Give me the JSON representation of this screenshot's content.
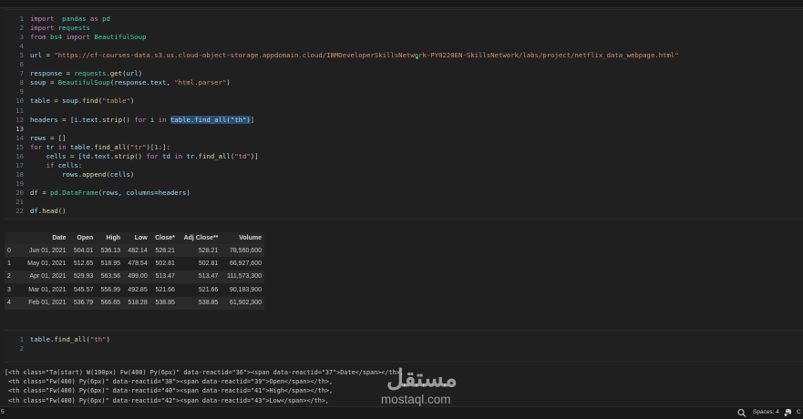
{
  "colors": {
    "background": "#1f1f1f",
    "keyword": "#c586c0",
    "string": "#ce9178",
    "function": "#dcdcaa",
    "variable": "#9cdcfe"
  },
  "cell1": {
    "lines": [
      {
        "num": "1",
        "tokens": [
          [
            "kw",
            "import"
          ],
          [
            "",
            "  "
          ],
          [
            "cls",
            "pandas"
          ],
          [
            "",
            " "
          ],
          [
            "kw",
            "as"
          ],
          [
            "",
            " "
          ],
          [
            "cls",
            "pd"
          ]
        ]
      },
      {
        "num": "2",
        "tokens": [
          [
            "kw",
            "import"
          ],
          [
            "",
            " "
          ],
          [
            "cls",
            "requests"
          ]
        ]
      },
      {
        "num": "3",
        "tokens": [
          [
            "kw",
            "from"
          ],
          [
            "",
            " "
          ],
          [
            "cls",
            "bs4"
          ],
          [
            "",
            " "
          ],
          [
            "kw",
            "import"
          ],
          [
            "",
            " "
          ],
          [
            "cls",
            "BeautifulSoup"
          ]
        ]
      },
      {
        "num": "4",
        "tokens": []
      },
      {
        "num": "5",
        "tokens": [
          [
            "var",
            "url"
          ],
          [
            "",
            " = "
          ],
          [
            "str",
            "\"https://cf-courses-data.s3.us.cloud-object-storage.appdomain.cloud/IBMDeveloperSkillsNetwork-PY0220EN-SkillsNetwork/labs/project/netflix_data_webpage.html\""
          ]
        ]
      },
      {
        "num": "6",
        "tokens": []
      },
      {
        "num": "7",
        "tokens": [
          [
            "var",
            "response"
          ],
          [
            "",
            " = "
          ],
          [
            "cls",
            "requests"
          ],
          [
            "",
            "."
          ],
          [
            "fn",
            "get"
          ],
          [
            "",
            "("
          ],
          [
            "var",
            "url"
          ],
          [
            "",
            ")"
          ]
        ]
      },
      {
        "num": "8",
        "tokens": [
          [
            "var",
            "soup"
          ],
          [
            "",
            " = "
          ],
          [
            "cls",
            "BeautifulSoup"
          ],
          [
            "",
            "("
          ],
          [
            "var",
            "response"
          ],
          [
            "",
            "."
          ],
          [
            "var",
            "text"
          ],
          [
            "",
            ", "
          ],
          [
            "str",
            "\"html.parser\""
          ],
          [
            "",
            ")"
          ]
        ]
      },
      {
        "num": "9",
        "tokens": []
      },
      {
        "num": "10",
        "tokens": [
          [
            "var",
            "table"
          ],
          [
            "",
            " = "
          ],
          [
            "var",
            "soup"
          ],
          [
            "",
            "."
          ],
          [
            "fn",
            "find"
          ],
          [
            "",
            "("
          ],
          [
            "str",
            "\"table\""
          ],
          [
            "",
            ")"
          ]
        ]
      },
      {
        "num": "11",
        "tokens": []
      },
      {
        "num": "12",
        "tokens": [
          [
            "var",
            "headers"
          ],
          [
            "",
            " = ["
          ],
          [
            "var",
            "i"
          ],
          [
            "",
            "."
          ],
          [
            "var",
            "text"
          ],
          [
            "",
            "."
          ],
          [
            "fn",
            "strip"
          ],
          [
            "",
            "() "
          ],
          [
            "kw",
            "for"
          ],
          [
            "",
            " "
          ],
          [
            "var",
            "i"
          ],
          [
            "",
            " "
          ],
          [
            "kw",
            "in"
          ],
          [
            "",
            " "
          ],
          [
            "hl",
            "table.find_all(\"th\")"
          ],
          [
            "",
            "]"
          ]
        ]
      },
      {
        "num": "13",
        "tokens": [],
        "active": true
      },
      {
        "num": "14",
        "tokens": [
          [
            "var",
            "rows"
          ],
          [
            "",
            " = []"
          ]
        ]
      },
      {
        "num": "15",
        "tokens": [
          [
            "kw",
            "for"
          ],
          [
            "",
            " "
          ],
          [
            "var",
            "tr"
          ],
          [
            "",
            " "
          ],
          [
            "kw",
            "in"
          ],
          [
            "",
            " "
          ],
          [
            "var",
            "table"
          ],
          [
            "",
            "."
          ],
          [
            "fn",
            "find_all"
          ],
          [
            "",
            "("
          ],
          [
            "str",
            "\"tr\""
          ],
          [
            "",
            ")["
          ],
          [
            "num",
            "1"
          ],
          [
            "",
            ":]:"
          ]
        ]
      },
      {
        "num": "16",
        "tokens": [
          [
            "",
            "    "
          ],
          [
            "var",
            "cells"
          ],
          [
            "",
            " = ["
          ],
          [
            "var",
            "td"
          ],
          [
            "",
            "."
          ],
          [
            "var",
            "text"
          ],
          [
            "",
            "."
          ],
          [
            "fn",
            "strip"
          ],
          [
            "",
            "() "
          ],
          [
            "kw",
            "for"
          ],
          [
            "",
            " "
          ],
          [
            "var",
            "td"
          ],
          [
            "",
            " "
          ],
          [
            "kw",
            "in"
          ],
          [
            "",
            " "
          ],
          [
            "var",
            "tr"
          ],
          [
            "",
            "."
          ],
          [
            "fn",
            "find_all"
          ],
          [
            "",
            "("
          ],
          [
            "str",
            "\"td\""
          ],
          [
            "",
            ")]"
          ]
        ]
      },
      {
        "num": "17",
        "tokens": [
          [
            "",
            "    "
          ],
          [
            "kw",
            "if"
          ],
          [
            "",
            " "
          ],
          [
            "var",
            "cells"
          ],
          [
            "",
            ":"
          ]
        ]
      },
      {
        "num": "18",
        "tokens": [
          [
            "",
            "        "
          ],
          [
            "var",
            "rows"
          ],
          [
            "",
            "."
          ],
          [
            "fn",
            "append"
          ],
          [
            "",
            "("
          ],
          [
            "var",
            "cells"
          ],
          [
            "",
            ")"
          ]
        ]
      },
      {
        "num": "19",
        "tokens": []
      },
      {
        "num": "20",
        "tokens": [
          [
            "var",
            "df"
          ],
          [
            "",
            " = "
          ],
          [
            "cls",
            "pd"
          ],
          [
            "",
            "."
          ],
          [
            "cls",
            "DataFrame"
          ],
          [
            "",
            "("
          ],
          [
            "var",
            "rows"
          ],
          [
            "",
            ", "
          ],
          [
            "var",
            "columns"
          ],
          [
            "",
            "="
          ],
          [
            "var",
            "headers"
          ],
          [
            "",
            ")"
          ]
        ]
      },
      {
        "num": "21",
        "tokens": []
      },
      {
        "num": "22",
        "tokens": [
          [
            "var",
            "df"
          ],
          [
            "",
            "."
          ],
          [
            "fn",
            "head"
          ],
          [
            "",
            "()"
          ]
        ]
      }
    ]
  },
  "dataframe": {
    "columns": [
      "",
      "Date",
      "Open",
      "High",
      "Low",
      "Close*",
      "Adj Close**",
      "Volume"
    ],
    "rows": [
      [
        "0",
        "Jun 01, 2021",
        "504.01",
        "536.13",
        "482.14",
        "528.21",
        "528.21",
        "78,560,600"
      ],
      [
        "1",
        "May 01, 2021",
        "512.65",
        "518.95",
        "478.54",
        "502.81",
        "502.81",
        "66,927,600"
      ],
      [
        "2",
        "Apr 01, 2021",
        "529.93",
        "563.56",
        "499.00",
        "513.47",
        "513.47",
        "111,573,300"
      ],
      [
        "3",
        "Mar 01, 2021",
        "545.57",
        "556.99",
        "492.85",
        "521.66",
        "521.66",
        "90,183,900"
      ],
      [
        "4",
        "Feb 01, 2021",
        "536.79",
        "566.65",
        "518.28",
        "538.85",
        "538.85",
        "61,902,300"
      ]
    ]
  },
  "cell2": {
    "lines": [
      {
        "num": "1",
        "tokens": [
          [
            "var",
            "table"
          ],
          [
            "",
            "."
          ],
          [
            "fn",
            "find_all"
          ],
          [
            "",
            "("
          ],
          [
            "str",
            "\"th\""
          ],
          [
            "",
            ")"
          ]
        ]
      },
      {
        "num": "2",
        "tokens": []
      }
    ]
  },
  "raw_output": [
    "[<th class=\"Ta(start) W(100px) Fw(400) Py(6px)\" data-reactid=\"36\"><span data-reactid=\"37\">Date</span></th>,",
    " <th class=\"Fw(400) Py(6px)\" data-reactid=\"38\"><span data-reactid=\"39\">Open</span></th>,",
    " <th class=\"Fw(400) Py(6px)\" data-reactid=\"40\"><span data-reactid=\"41\">High</span></th>,",
    " <th class=\"Fw(400) Py(6px)\" data-reactid=\"42\"><span data-reactid=\"43\">Low</span></th>,"
  ],
  "watermark": {
    "arabic": "مستقل",
    "latin": "mostaql.com"
  },
  "status_bar": {
    "left": "5",
    "spaces": "Spaces: 4",
    "right": "C",
    "search_icon": "search-icon",
    "python_icon": "python-icon"
  }
}
